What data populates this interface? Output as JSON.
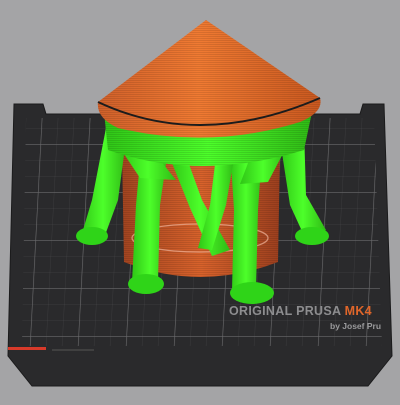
{
  "bed": {
    "brand_prefix": "ORIGINAL ",
    "brand_name": "PRUSA ",
    "brand_model": "MK4",
    "subtitle": "by Josef Pru"
  },
  "object": {
    "roof_color": "#e06d2c",
    "body_color": "#c95a2a",
    "support_color": "#36e51a",
    "bed_color": "#2b2b2d",
    "background_color": "#a4a4a6"
  }
}
